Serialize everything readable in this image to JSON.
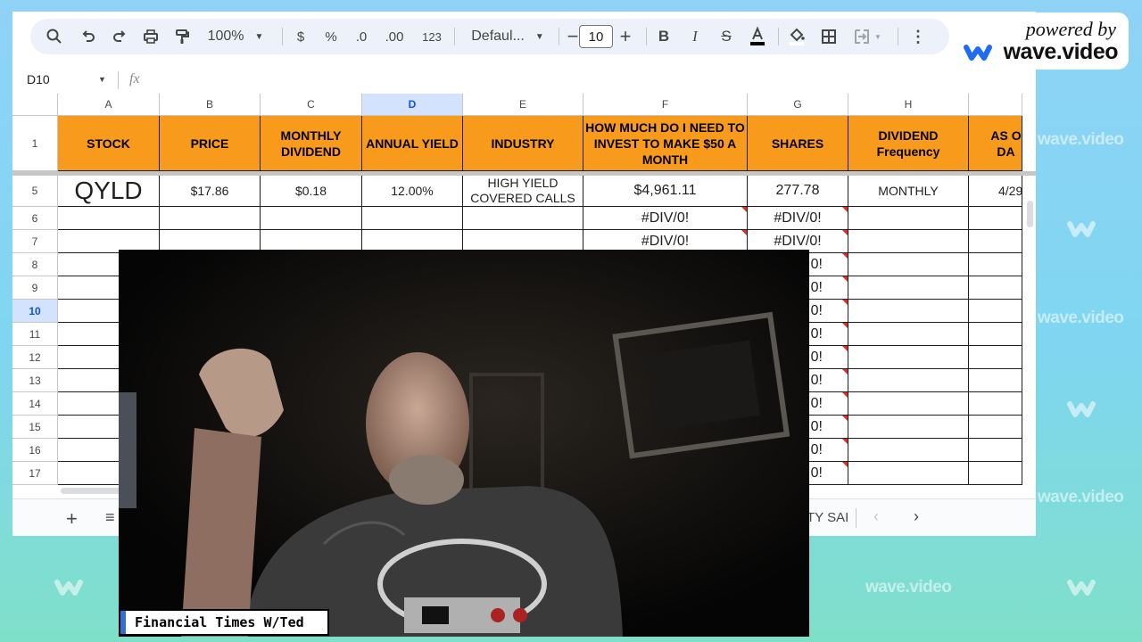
{
  "toolbar": {
    "zoom": "100%",
    "currency": "$",
    "percent": "%",
    "dec_decrease": ".0",
    "dec_increase": ".00",
    "number_format": "123",
    "font": "Defaul...",
    "font_size": "10"
  },
  "formula_bar": {
    "cell_ref": "D10",
    "fx": "fx"
  },
  "columns": [
    "A",
    "B",
    "C",
    "D",
    "E",
    "F",
    "G",
    "H"
  ],
  "header_row": {
    "row_num": "1",
    "labels": [
      "STOCK",
      "PRICE",
      "MONTHLY DIVIDEND",
      "ANNUAL YIELD",
      "INDUSTRY",
      "HOW MUCH DO I NEED TO INVEST TO MAKE $50 A MONTH",
      "SHARES",
      "DIVIDEND Frequency",
      "AS O DA"
    ]
  },
  "row5": {
    "row_num": "5",
    "stock": "QYLD",
    "price": "$17.86",
    "monthly_dividend": "$0.18",
    "annual_yield": "12.00%",
    "industry": "HIGH YIELD COVERED CALLS",
    "invest": "$4,961.11",
    "shares": "277.78",
    "frequency": "MONTHLY",
    "as_of": "4/29"
  },
  "rows": [
    "6",
    "7",
    "8",
    "9",
    "10",
    "11",
    "12",
    "13",
    "14",
    "15",
    "16",
    "17"
  ],
  "error_text": "#DIV/0!",
  "error_partial": "0!",
  "sheet_tab_partial": "TY SAI",
  "badge": {
    "powered_by": "powered by",
    "brand": "wave.video"
  },
  "watermark": "wave.video",
  "caption": "Financial Times W/Ted"
}
